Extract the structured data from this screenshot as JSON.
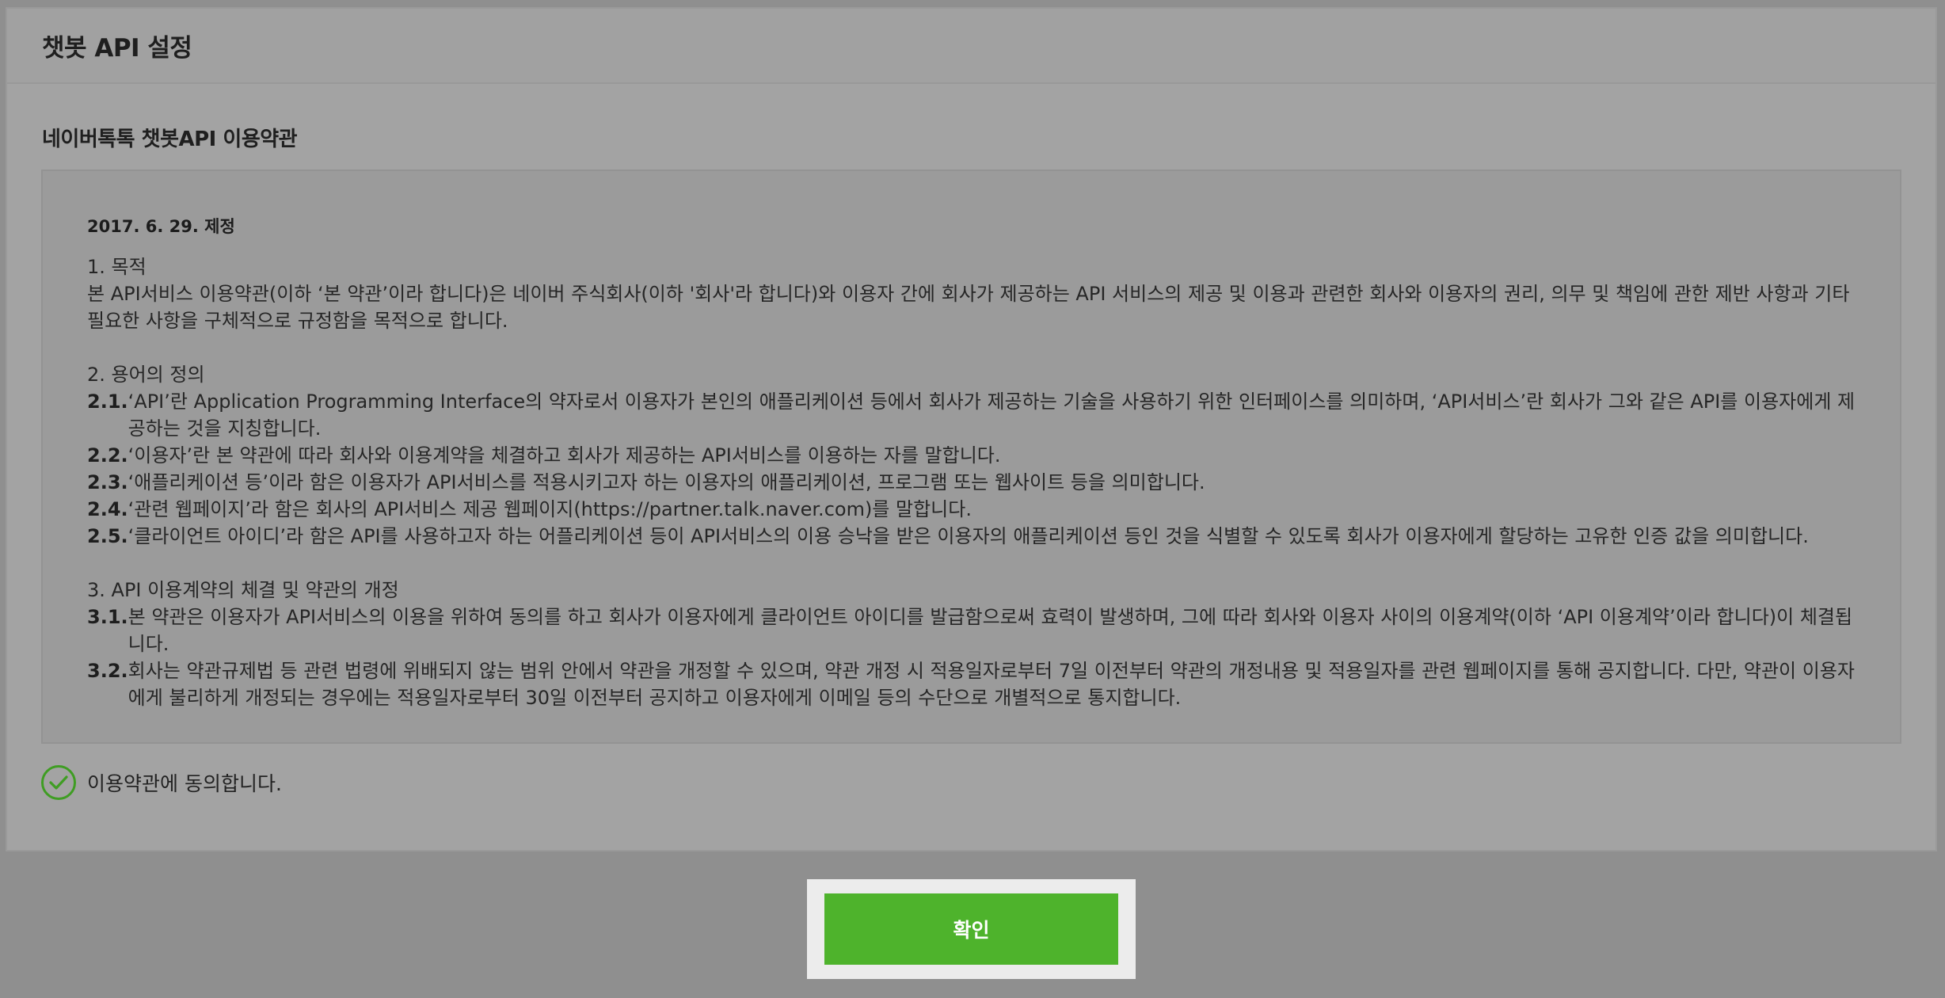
{
  "header": {
    "title": "챗봇 API 설정"
  },
  "terms": {
    "title": "네이버톡톡 챗봇API 이용약관",
    "date": "2017. 6. 29. 제정",
    "sec1_title": "1. 목적",
    "sec1_body": "본 API서비스 이용약관(이하 ‘본 약관’이라 합니다)은 네이버 주식회사(이하 '회사'라 합니다)와 이용자 간에 회사가 제공하는 API 서비스의 제공 및 이용과 관련한 회사와 이용자의 권리, 의무 및 책임에 관한 제반 사항과 기타 필요한 사항을 구체적으로 규정함을 목적으로 합니다.",
    "sec2_title": "2. 용어의 정의",
    "sec2_items": [
      {
        "num": "2.1.",
        "text": "‘API’란 Application Programming Interface의 약자로서 이용자가 본인의 애플리케이션 등에서 회사가 제공하는 기술을 사용하기 위한 인터페이스를 의미하며, ‘API서비스’란 회사가 그와 같은 API를 이용자에게 제공하는 것을 지칭합니다."
      },
      {
        "num": "2.2.",
        "text": "‘이용자’란 본 약관에 따라 회사와 이용계약을 체결하고 회사가 제공하는 API서비스를 이용하는 자를 말합니다."
      },
      {
        "num": "2.3.",
        "text": "‘애플리케이션 등’이라 함은 이용자가 API서비스를 적용시키고자 하는 이용자의 애플리케이션, 프로그램 또는 웹사이트 등을 의미합니다."
      },
      {
        "num": "2.4.",
        "text": "‘관련 웹페이지’라 함은 회사의 API서비스 제공 웹페이지(https://partner.talk.naver.com)를 말합니다."
      },
      {
        "num": "2.5.",
        "text": "‘클라이언트 아이디’라 함은 API를 사용하고자 하는 어플리케이션 등이 API서비스의 이용 승낙을 받은 이용자의 애플리케이션 등인 것을 식별할 수 있도록 회사가 이용자에게 할당하는 고유한 인증 값을 의미합니다."
      }
    ],
    "sec3_title": "3. API 이용계약의 체결 및 약관의 개정",
    "sec3_items": [
      {
        "num": "3.1.",
        "text": "본 약관은 이용자가 API서비스의 이용을 위하여 동의를 하고 회사가 이용자에게 클라이언트 아이디를 발급함으로써 효력이 발생하며, 그에 따라 회사와 이용자 사이의 이용계약(이하 ‘API 이용계약’이라 합니다)이 체결됩니다."
      },
      {
        "num": "3.2.",
        "text": "회사는 약관규제법 등 관련 법령에 위배되지 않는 범위 안에서 약관을 개정할 수 있으며, 약관 개정 시 적용일자로부터 7일 이전부터 약관의 개정내용 및 적용일자를 관련 웹페이지를 통해 공지합니다. 다만, 약관이 이용자에게 불리하게 개정되는 경우에는 적용일자로부터 30일 이전부터 공지하고 이용자에게 이메일 등의 수단으로 개별적으로 통지합니다."
      }
    ]
  },
  "agree": {
    "label": "이용약관에 동의합니다.",
    "checked": true,
    "icon": "check-circle-icon",
    "color": "#3f9d23"
  },
  "confirm": {
    "label": "확인",
    "color": "#4eb32c"
  }
}
